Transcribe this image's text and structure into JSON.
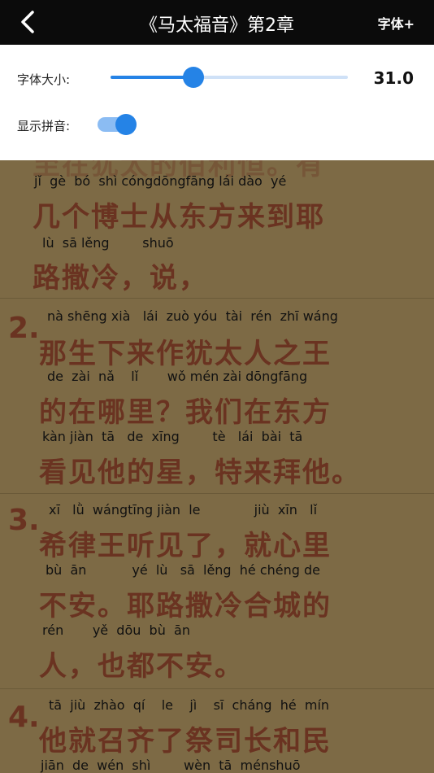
{
  "header": {
    "title": "《马太福音》第2章",
    "font_button": "字体+"
  },
  "settings": {
    "font_size_label": "字体大小:",
    "font_size_value": "31.0",
    "font_size_fraction": 0.35,
    "pinyin_label": "显示拼音:",
    "pinyin_on": true
  },
  "content": {
    "lines": [
      {
        "pinyin": "jǐ  gè  bó  shì cóngdōngfāng lái dào  yé",
        "hanzi": "几个博士从东方来到耶"
      },
      {
        "pinyin": "lù  sā lěng        shuō",
        "hanzi": "路撒冷，说，"
      },
      {
        "pinyin": "nà shēng xià   lái  zuò yóu  tài  rén  zhī wáng",
        "hanzi": "那生下来作犹太人之王"
      },
      {
        "pinyin": "de  zài  nǎ    lǐ       wǒ mén zài dōngfāng",
        "hanzi": "的在哪里？我们在东方"
      },
      {
        "pinyin": "kàn jiàn  tā   de  xīng        tè   lái  bài  tā",
        "hanzi": "看见他的星，特来拜他。"
      },
      {
        "pinyin": "xī   lǜ  wángtīng jiàn  le             jiù  xīn   lǐ",
        "hanzi": "希律王听见了，就心里"
      },
      {
        "pinyin": "bù  ān           yé  lù   sā  lěng  hé chéng de",
        "hanzi": "不安。耶路撒冷合城的"
      },
      {
        "pinyin": "rén       yě  dōu  bù  ān",
        "hanzi": "人，也都不安。"
      },
      {
        "pinyin": "tā  jiù  zhào  qí    le    jì    sī  cháng  hé  mín",
        "hanzi": "他就召齐了祭司长和民"
      },
      {
        "pinyin": "jiān  de  wén  shì        wèn  tā  ménshuō",
        "hanzi": ""
      }
    ],
    "verse_numbers": [
      "2.",
      "3.",
      "4."
    ]
  }
}
